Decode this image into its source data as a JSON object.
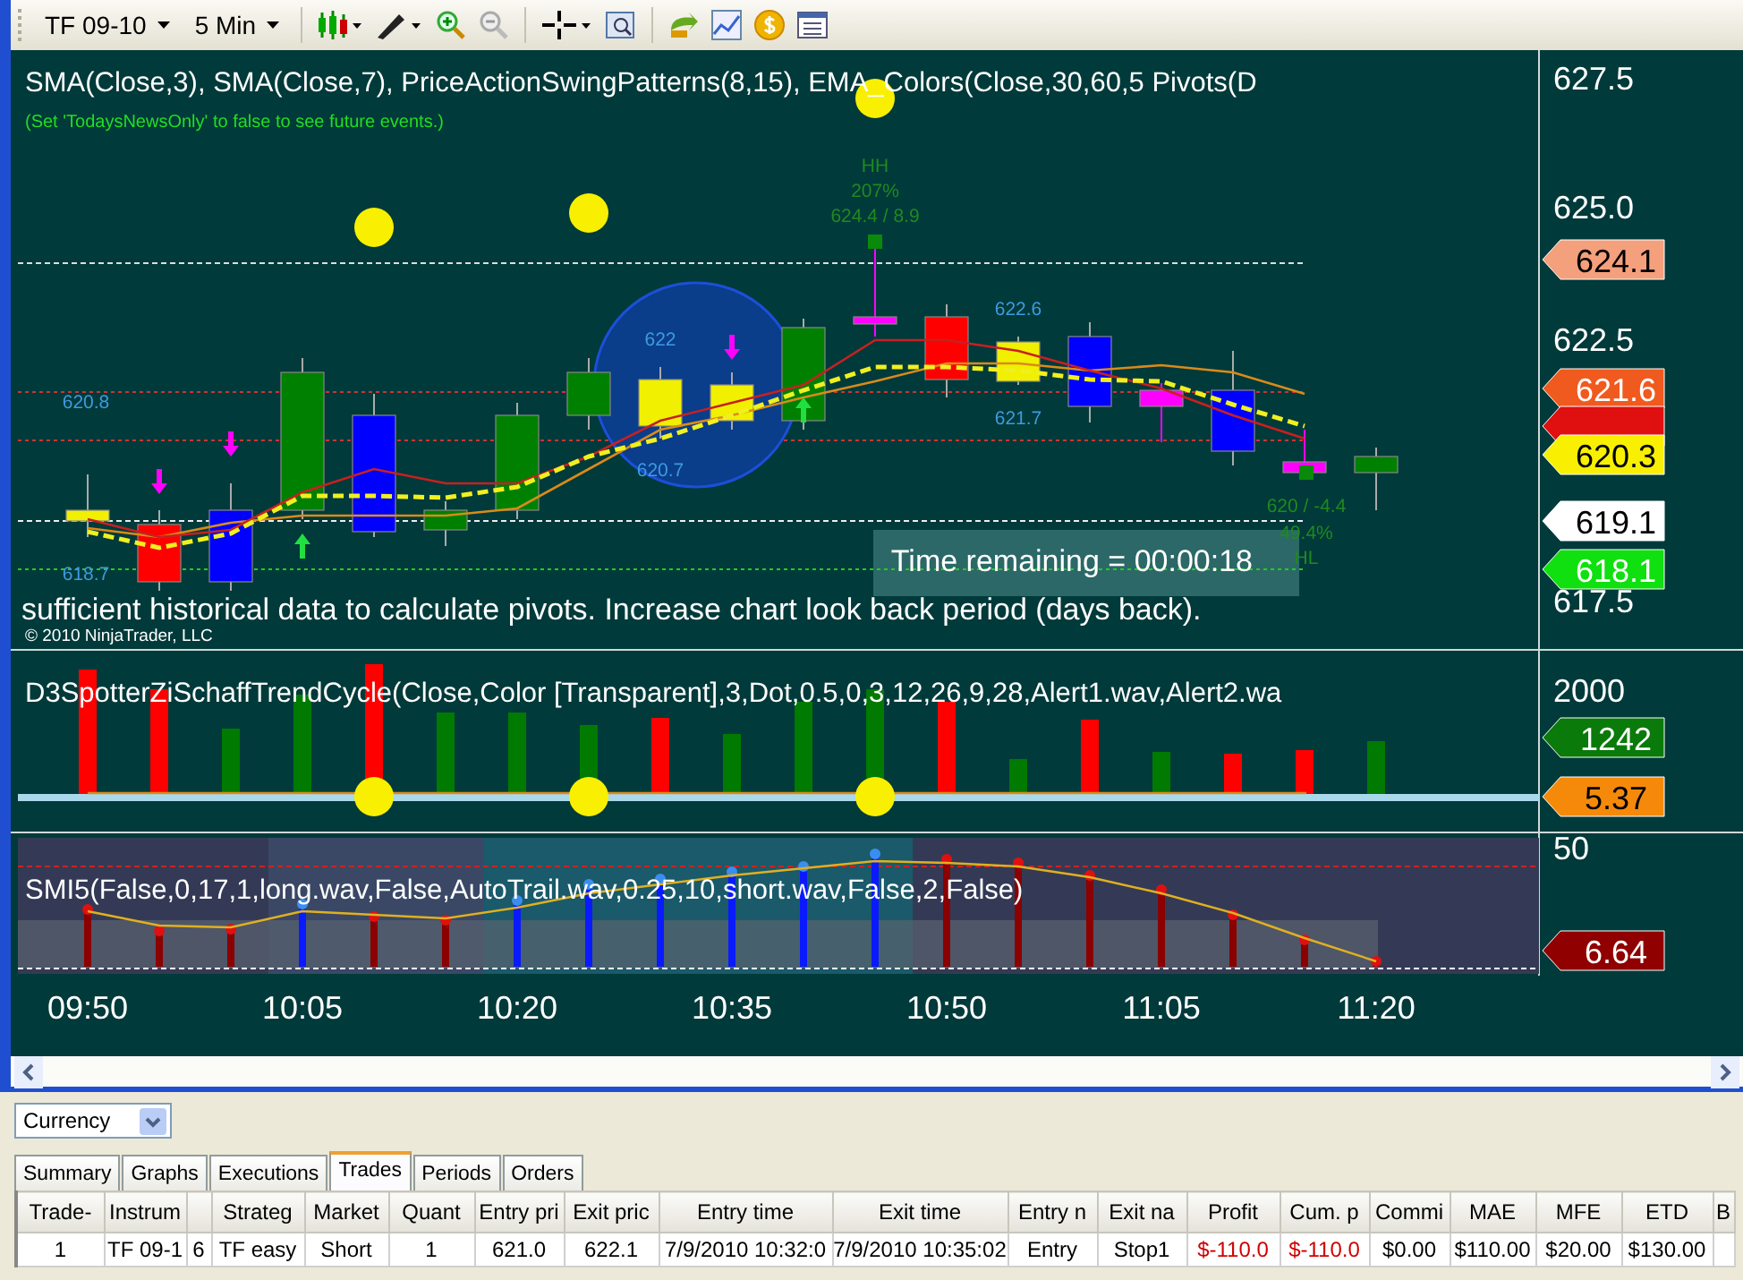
{
  "toolbar": {
    "instrument": "TF 09-10",
    "interval": "5 Min"
  },
  "price_panel": {
    "title": "SMA(Close,3),  SMA(Close,7),  PriceActionSwingPatterns(8,15),  EMA_Colors(Close,30,60,5   Pivots(D",
    "news_note": "(Set 'TodaysNewsOnly' to false to see future events.)",
    "axis_labels": [
      "627.5",
      "625.0",
      "622.5",
      "617.5"
    ],
    "price_flags": [
      {
        "text": "624.1",
        "color": "#f4a07c"
      },
      {
        "text": "621.6",
        "color": "#f05a1e"
      },
      {
        "color": "#e01010"
      },
      {
        "text": "620.3",
        "color": "#f8f000"
      },
      {
        "text": "619.1",
        "color": "#ffffff"
      },
      {
        "text": "618.1",
        "color": "#10e010"
      }
    ],
    "swing_labels": [
      "HH",
      "207%",
      "624.4 / 8.9",
      "622.6",
      "621.7",
      "622",
      "620.7",
      "620.8",
      "618.7",
      "620 / -4.4",
      "49.4%",
      "HL"
    ],
    "pivot_message": "sufficient historical data to calculate pivots. Increase chart look back period (days back).",
    "timer": "Time remaining = 00:00:18",
    "copyright": "© 2010 NinjaTrader, LLC"
  },
  "cycle_panel": {
    "title": "D3SpotterZiSchaffTrendCycle(Close,Color [Transparent],3,Dot,0.5,0,3,12,26,9,28,Alert1.wav,Alert2.wa",
    "axis_labels": [
      "2000"
    ],
    "flags": [
      {
        "text": "1242",
        "color": "#0a7a0a"
      },
      {
        "text": "5.37",
        "color": "#f58a0a"
      }
    ]
  },
  "smi_panel": {
    "title": "SMI5(False,0,17,1,long.wav,False,AutoTrail.wav,0.25,10,short.wav,False,2,False)",
    "axis_labels": [
      "50"
    ],
    "flags": [
      {
        "text": "6.64",
        "color": "#900000"
      }
    ]
  },
  "time_axis": [
    "09:50",
    "10:05",
    "10:20",
    "10:35",
    "10:50",
    "11:05",
    "11:20"
  ],
  "performance": {
    "display_unit": "Currency",
    "tabs": [
      {
        "label": "Summary",
        "selected": false
      },
      {
        "label": "Graphs",
        "selected": false
      },
      {
        "label": "Executions",
        "selected": false
      },
      {
        "label": "Trades",
        "selected": true
      },
      {
        "label": "Periods",
        "selected": false
      },
      {
        "label": "Orders",
        "selected": false
      }
    ],
    "table": {
      "columns": [
        {
          "label": "Trade-"
        },
        {
          "label": "Instrum"
        },
        {},
        {
          "label": "Strateg"
        },
        {
          "label": "Market"
        },
        {
          "label": "Quant"
        },
        {
          "label": "Entry pri"
        },
        {
          "label": "Exit pric"
        },
        {
          "label": "Entry time"
        },
        {
          "label": "Exit time"
        },
        {
          "label": "Entry n"
        },
        {
          "label": "Exit na"
        },
        {
          "label": "Profit"
        },
        {
          "label": "Cum. p"
        },
        {
          "label": "Commi"
        },
        {
          "label": "MAE"
        },
        {
          "label": "MFE"
        },
        {
          "label": "ETD"
        },
        {
          "label": "B"
        }
      ],
      "rows": [
        {
          "cells": [
            {
              "text": "1",
              "loss": false
            },
            {
              "text": "TF 09-1",
              "loss": false
            },
            {
              "text": "6",
              "loss": false
            },
            {
              "text": "TF easy",
              "loss": false
            },
            {
              "text": "Short",
              "loss": false
            },
            {
              "text": "1",
              "loss": false
            },
            {
              "text": "621.0",
              "loss": false
            },
            {
              "text": "622.1",
              "loss": false
            },
            {
              "text": "7/9/2010 10:32:0",
              "loss": false
            },
            {
              "text": "7/9/2010 10:35:02",
              "loss": false
            },
            {
              "text": "Entry",
              "loss": false
            },
            {
              "text": "Stop1",
              "loss": false
            },
            {
              "text": "$-110.0",
              "loss": true
            },
            {
              "text": "$-110.0",
              "loss": true
            },
            {
              "text": "$0.00",
              "loss": false
            },
            {
              "text": "$110.00",
              "loss": false
            },
            {
              "text": "$20.00",
              "loss": false
            },
            {
              "text": "$130.00",
              "loss": false
            }
          ]
        }
      ]
    }
  }
}
